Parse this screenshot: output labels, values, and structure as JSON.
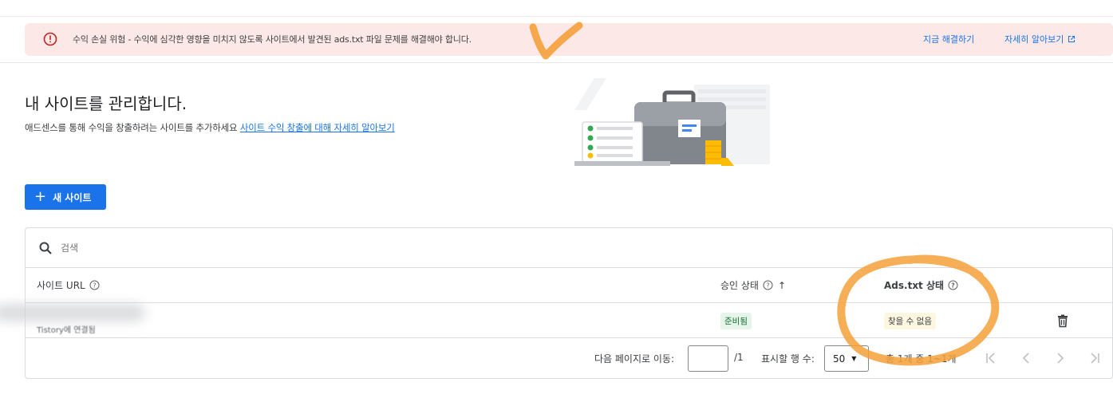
{
  "alert": {
    "message": "수익 손실 위험 - 수익에 심각한 영향을 미치지 않도록 사이트에서 발견된 ads.txt 파일 문제를 해결해야 합니다.",
    "fix_link": "지금 해결하기",
    "learn_link": "자세히 알아보기",
    "icon": "error-icon",
    "color": "#fce8e6"
  },
  "page": {
    "title": "내 사이트를 관리합니다.",
    "subtitle": "애드센스를 통해 수익을 창출하려는 사이트를 추가하세요",
    "subtitle_link": "사이트 수익 창출에 대해 자세히 알아보기"
  },
  "actions": {
    "new_site": "새 사이트",
    "accent": "#1a73e8"
  },
  "search": {
    "placeholder": "검색"
  },
  "table": {
    "columns": {
      "url": "사이트 URL",
      "approval": "승인 상태",
      "ads_txt": "Ads.txt 상태"
    },
    "rows": [
      {
        "url_sub": "Tistory에 연결됨",
        "approval_status": "준비됨",
        "ads_txt_status": "찾을 수 없음"
      }
    ]
  },
  "pagination": {
    "goto_label": "다음 페이지로 이동:",
    "page_value": "",
    "total_pages": "/1",
    "rows_label": "표시할 행 수:",
    "rows_value": "50",
    "range": "총 1개 중 1~1개"
  }
}
